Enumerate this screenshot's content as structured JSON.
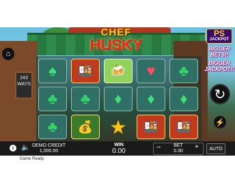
{
  "logo": {
    "line1": "CHEF",
    "line2": "HUSKY"
  },
  "promo": {
    "badge": "PS",
    "badge_sub": "JACKPOT",
    "line1": "BIGGER BETS!!",
    "line2": "BIGGER JACKPOT!!"
  },
  "chalkboard": {
    "text": "243 WAYS"
  },
  "reels": [
    [
      "spade-symbol",
      "food-platter-symbol",
      "beer-mugs-symbol",
      "heart-symbol",
      "club-symbol"
    ],
    [
      "club-symbol",
      "club-symbol",
      "diamond-symbol",
      "diamond-symbol",
      "diamond-symbol"
    ],
    [
      "club-symbol",
      "gold-pot-symbol",
      "star-scatter-symbol",
      "food-platter-symbol",
      "food-platter-symbol"
    ]
  ],
  "bottom_bar": {
    "credit_label": "DEMO CREDIT",
    "credit_value": "1,000.00",
    "win_label": "WIN",
    "win_value": "0.00",
    "bet_label": "BET",
    "bet_value": "0.30",
    "bet_minus": "−",
    "bet_plus": "+",
    "auto_label": "AUTO"
  },
  "status": {
    "text": "Game Ready"
  },
  "icons": {
    "home": "home-icon",
    "info": "info-icon",
    "sound": "speaker-icon",
    "spin": "refresh-icon",
    "turbo": "lightning-icon"
  }
}
